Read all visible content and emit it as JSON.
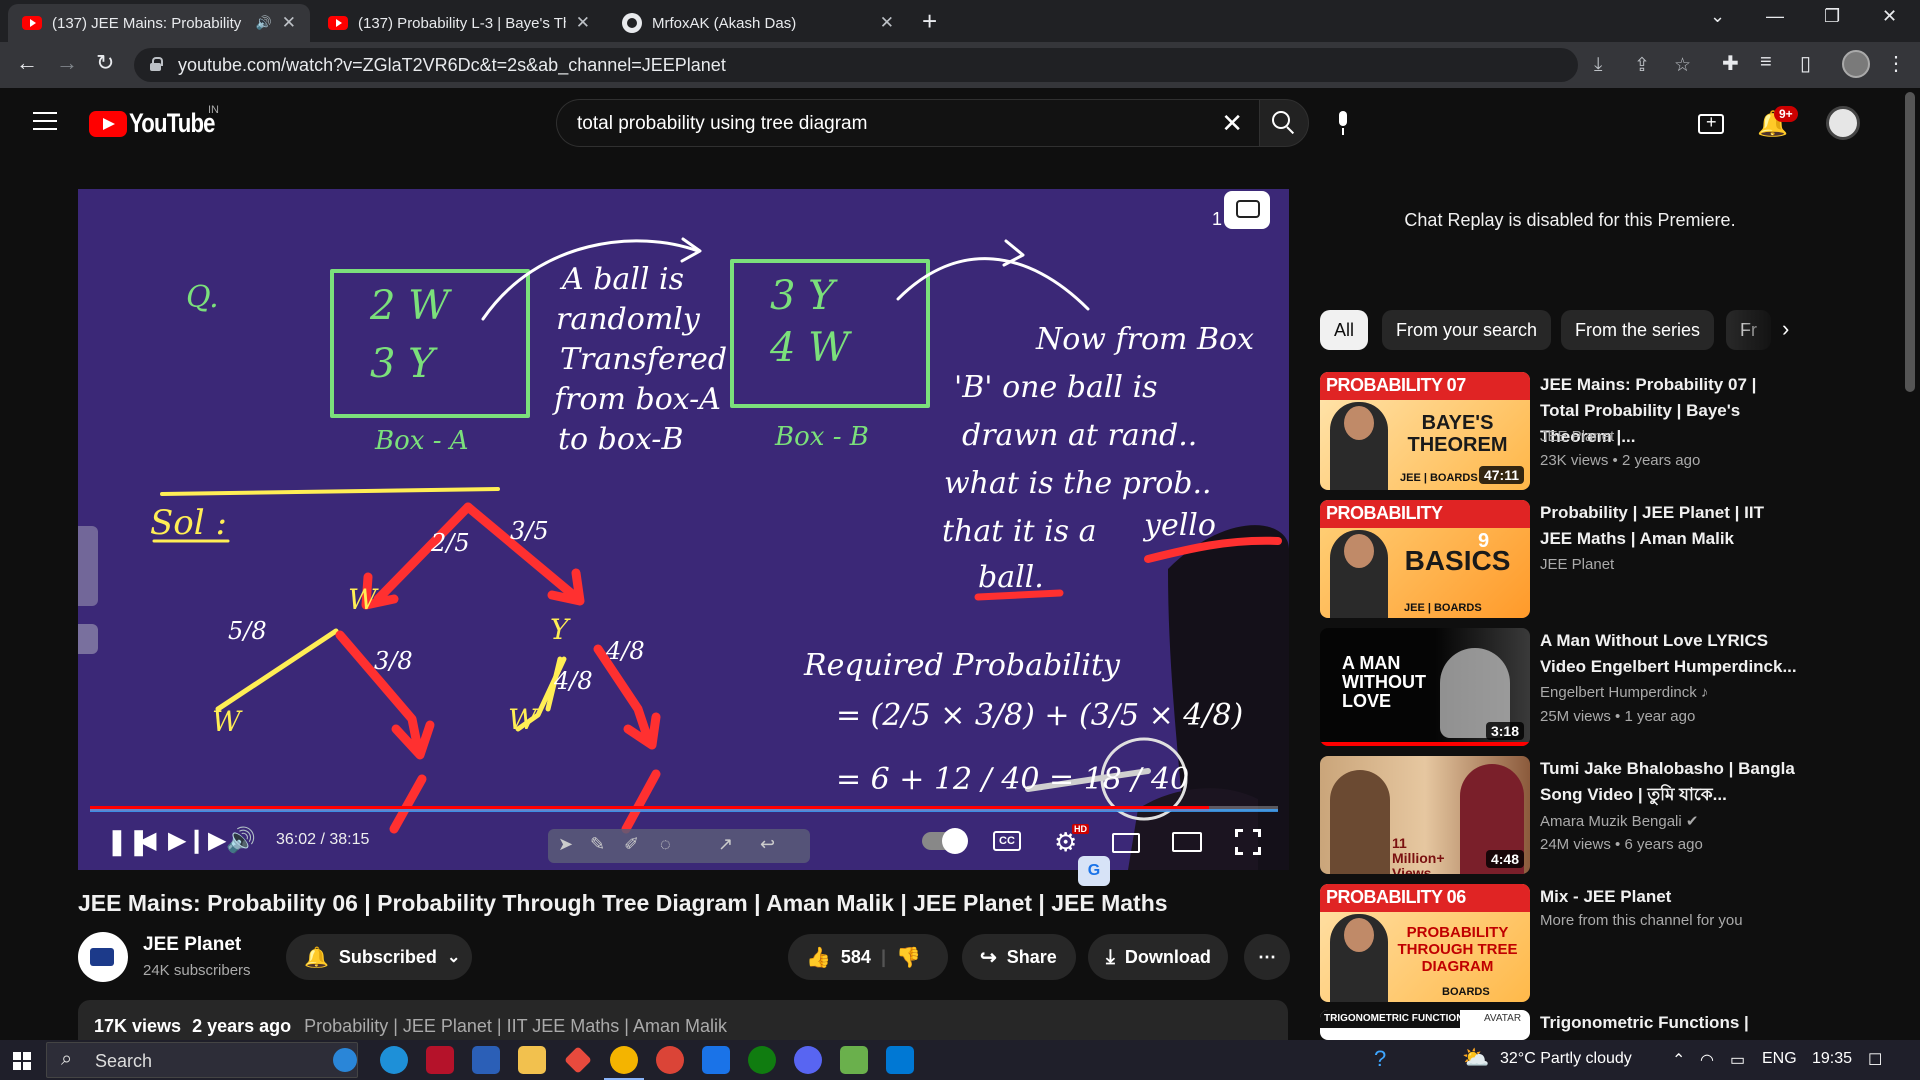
{
  "browser": {
    "tabs": [
      {
        "title": "(137) JEE Mains: Probability 0",
        "active": true
      },
      {
        "title": "(137) Probability L-3 | Baye's The",
        "active": false
      },
      {
        "title": "MrfoxAK (Akash Das)",
        "active": false
      }
    ],
    "url": "youtube.com/watch?v=ZGlaT2VR6Dc&t=2s&ab_channel=JEEPlanet"
  },
  "header": {
    "logo_text": "YouTube",
    "region": "IN",
    "search_query": "total probability using tree diagram",
    "notification_count": "9+"
  },
  "player": {
    "time_display": "36:02 / 38:15",
    "progress_fraction": 0.942,
    "board_label": "1"
  },
  "video": {
    "title": "JEE Mains: Probability 06 | Probability Through Tree Diagram | Aman Malik | JEE Planet | JEE Maths",
    "channel": "JEE Planet",
    "subscribers": "24K subscribers",
    "subscribe_label": "Subscribed",
    "likes": "584",
    "share_label": "Share",
    "download_label": "Download",
    "views": "17K views",
    "age": "2 years ago",
    "tags": "Probability | JEE Planet | IIT JEE Maths | Aman Malik"
  },
  "sidebar": {
    "chat_note": "Chat Replay is disabled for this Premiere.",
    "chips": [
      "All",
      "From your search",
      "From the series",
      "Fr"
    ],
    "recommendations": [
      {
        "thumb_band": "PROBABILITY 07",
        "thumb_text": "BAYE'S THEOREM",
        "thumb_footer": "JEE | BOARDS",
        "duration": "47:11",
        "title": "JEE Mains: Probability 07 | Total Probability | Baye's Theorem |...",
        "channel": "JEE Planet",
        "meta": "23K views • 2 years ago"
      },
      {
        "thumb_band": "PROBABILITY",
        "thumb_text": "BASICS",
        "thumb_footer": "JEE | BOARDS",
        "thumb_count": "9",
        "title": "Probability | JEE Planet | IIT JEE Maths | Aman Malik",
        "channel": "JEE Planet",
        "meta": ""
      },
      {
        "thumb_text": "A MAN WITHOUT LOVE",
        "duration": "3:18",
        "title": "A Man Without Love LYRICS Video Engelbert Humperdinck...",
        "channel": "Engelbert Humperdinck ♪",
        "meta": "25M views • 1 year ago"
      },
      {
        "thumb_text": "11 Million+ Views",
        "duration": "4:48",
        "title": "Tumi Jake Bhalobasho | Bangla Song Video | তুমি যাকে...",
        "channel": "Amara Muzik Bengali ✔",
        "meta": "24M views • 6 years ago"
      },
      {
        "thumb_band": "PROBABILITY 06",
        "thumb_text": "PROBABILITY THROUGH TREE DIAGRAM",
        "thumb_footer": "BOARDS",
        "title": "Mix - JEE Planet",
        "channel": "More from this channel for you",
        "meta": ""
      },
      {
        "thumb_band": "TRIGONOMETRIC FUNCTIONS",
        "thumb_footer": "AVATAR",
        "title": "Trigonometric Functions |",
        "channel": "",
        "meta": ""
      }
    ]
  },
  "taskbar": {
    "search_placeholder": "Search",
    "weather": "32°C  Partly cloudy",
    "language": "ENG",
    "clock": "19:35"
  },
  "colors": {
    "board": "#3b2877",
    "chalk_green": "#7be07b",
    "chalk_white": "#ffffff",
    "chalk_red": "#ff3030",
    "chalk_yellow": "#ffee55",
    "progress": "#ff0000"
  }
}
